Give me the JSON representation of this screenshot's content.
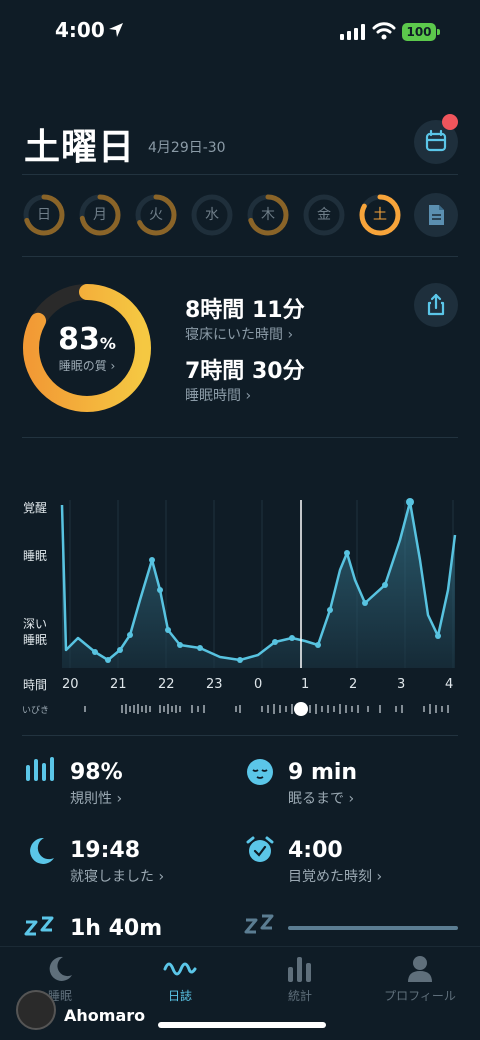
{
  "status": {
    "time": "4:00",
    "battery": "100"
  },
  "header": {
    "day": "土曜日",
    "date_range": "4月29日-30"
  },
  "week": {
    "days": [
      {
        "label": "日",
        "progress": 0.7
      },
      {
        "label": "月",
        "progress": 0.72
      },
      {
        "label": "火",
        "progress": 0.68
      },
      {
        "label": "水",
        "progress": 0
      },
      {
        "label": "木",
        "progress": 0.7
      },
      {
        "label": "金",
        "progress": 0
      },
      {
        "label": "土",
        "progress": 0.83
      }
    ]
  },
  "summary": {
    "quality_value": "83",
    "quality_unit": "%",
    "quality_label": "睡眠の質 ›",
    "quality_progress": 0.83,
    "in_bed_value": "8時間 11分",
    "in_bed_label": "寝床にいた時間 ›",
    "asleep_value": "7時間 30分",
    "asleep_label": "睡眠時間 ›"
  },
  "graph": {
    "y_labels": {
      "awake": "覚醒",
      "sleep": "睡眠",
      "deep": "深い\n睡眠"
    },
    "time_label": "時間",
    "snore_label": "いびき",
    "hours": [
      "20",
      "21",
      "22",
      "23",
      "0",
      "1",
      "2",
      "3",
      "4"
    ]
  },
  "metrics": [
    {
      "value": "98%",
      "label": "規則性 ›",
      "icon": "regularity-icon"
    },
    {
      "value": "9 min",
      "label": "眠るまで ›",
      "icon": "sleepy-face-icon"
    },
    {
      "value": "19:48",
      "label": "就寝しました ›",
      "icon": "moon-icon"
    },
    {
      "value": "4:00",
      "label": "目覚めた時刻 ›",
      "icon": "alarm-icon"
    },
    {
      "value": "1h 40m",
      "label": "",
      "icon": "zzz-icon"
    }
  ],
  "tabs": [
    {
      "label": "睡眠",
      "icon": "moon-icon"
    },
    {
      "label": "日誌",
      "icon": "wave-icon",
      "active": true
    },
    {
      "label": "統計",
      "icon": "bar-chart-icon"
    },
    {
      "label": "プロフィール",
      "icon": "person-icon"
    }
  ],
  "watermark": "Ahomaro",
  "colors": {
    "accent": "#5bc6e8",
    "orange": "#f7a43a",
    "yellow": "#f5c842",
    "background": "#0f1c26"
  }
}
